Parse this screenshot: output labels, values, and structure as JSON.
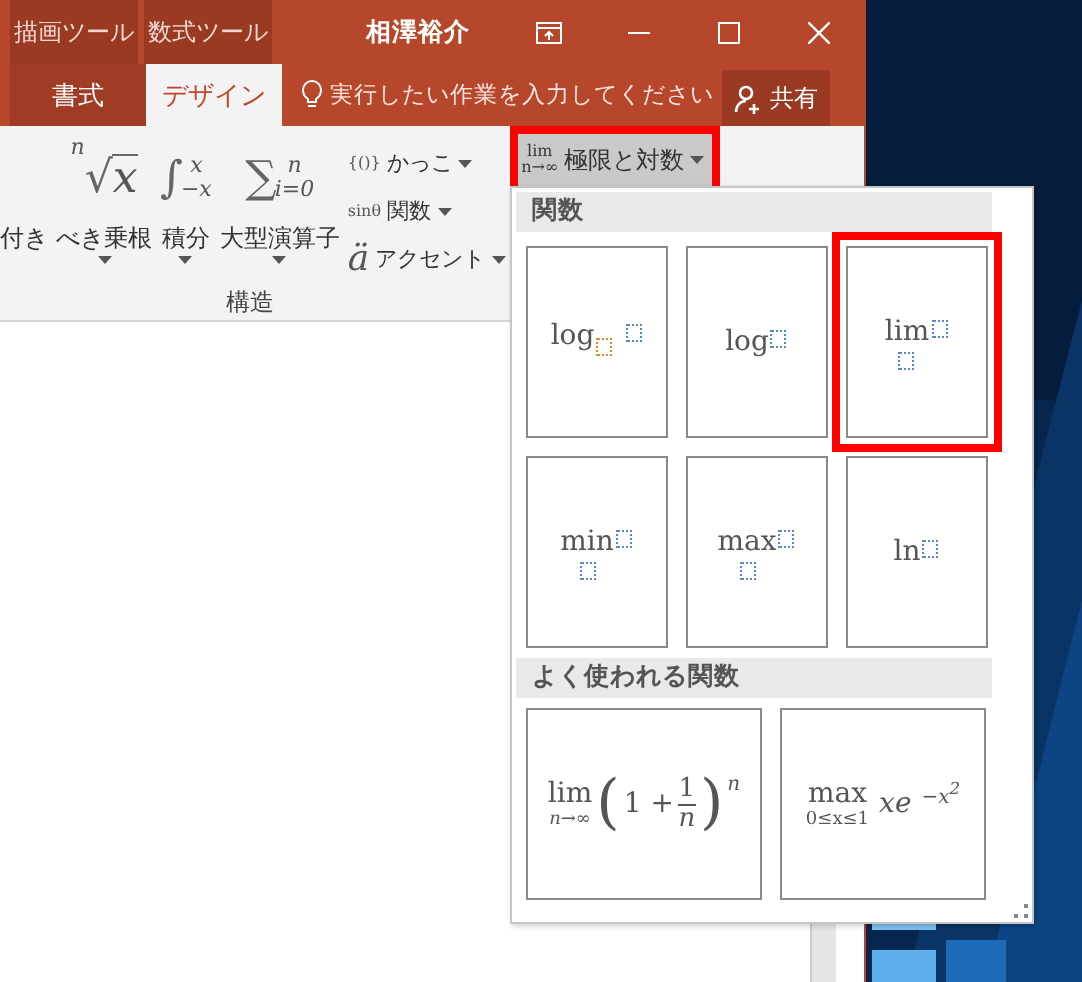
{
  "title_bar": {
    "context_tabs": [
      {
        "label": "描画ツール"
      },
      {
        "label": "数式ツール"
      }
    ],
    "title": "相澤裕介"
  },
  "ribbon_tabs": [
    {
      "label": "書式",
      "selected": false
    },
    {
      "label": "デザイン",
      "selected": true
    }
  ],
  "tell_me": {
    "placeholder": "実行したい作業を入力してください"
  },
  "share_button": {
    "label": "共有"
  },
  "ribbon": {
    "big_buttons": [
      {
        "kind": "cut",
        "label": "付き"
      },
      {
        "kind": "radical",
        "sign": "√",
        "top": "n",
        "base": "x",
        "label": "べき乗根"
      },
      {
        "kind": "operator",
        "sign": "∫",
        "top": "x",
        "bottom": "−x",
        "label": "積分"
      },
      {
        "kind": "operator",
        "sign": "∑",
        "top": "n",
        "bottom": "i=0",
        "label": "大型演算子"
      }
    ],
    "small_buttons": [
      {
        "prefix": "{()}",
        "label": "かっこ"
      },
      {
        "prefix": "sinθ",
        "label": "関数"
      },
      {
        "prefix": "ä",
        "label": "アクセント"
      }
    ],
    "limit_button": {
      "top": "lim",
      "bottom": "n→∞",
      "label": "極限と対数",
      "highlighted": true
    },
    "group_label": "構造"
  },
  "dropdown": {
    "sections": [
      {
        "title": "関数",
        "kind": "small",
        "items": [
          {
            "kind": "subscript",
            "func": "log",
            "highlighted": false
          },
          {
            "kind": "plain",
            "func": "log",
            "highlighted": false
          },
          {
            "kind": "below",
            "func": "lim",
            "highlighted": true
          },
          {
            "kind": "below",
            "func": "min",
            "highlighted": false
          },
          {
            "kind": "below",
            "func": "max",
            "highlighted": false
          },
          {
            "kind": "plain",
            "func": "ln",
            "highlighted": false
          }
        ]
      },
      {
        "title": "よく使われる関数",
        "kind": "large",
        "items": [
          {
            "kind": "limit_power",
            "func": "lim",
            "under": "n→∞",
            "open": "(",
            "lead": "1 +",
            "num": "1",
            "den": "n",
            "close": ")",
            "exp": "n",
            "highlighted": false
          },
          {
            "kind": "max_exp",
            "func": "max",
            "under": "0≤x≤1",
            "body": "xe",
            "exp": "−x",
            "exp_power": "2",
            "highlighted": false
          }
        ]
      }
    ]
  }
}
